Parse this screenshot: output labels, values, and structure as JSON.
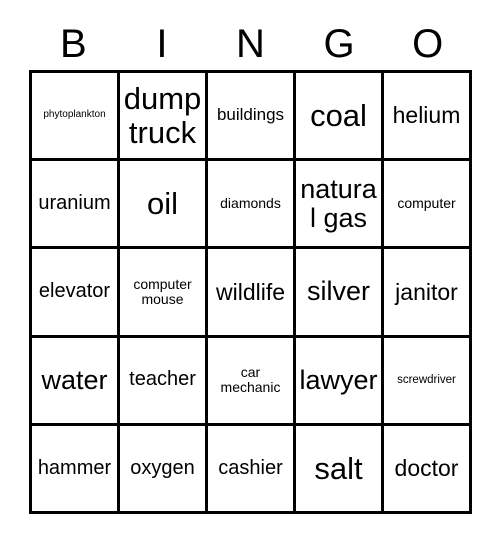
{
  "card": {
    "title": "BINGO",
    "header_letters": [
      "B",
      "I",
      "N",
      "G",
      "O"
    ],
    "columns": 5,
    "rows": 5,
    "border_color": "#000000",
    "background_color": "#ffffff",
    "text_color": "#000000",
    "cells": [
      [
        {
          "text": "phytoplankton",
          "size": "tiny"
        },
        {
          "text": "dump truck",
          "size": "xxl"
        },
        {
          "text": "buildings",
          "size": "s"
        },
        {
          "text": "coal",
          "size": "xxl"
        },
        {
          "text": "helium",
          "size": "l"
        }
      ],
      [
        {
          "text": "uranium",
          "size": "m"
        },
        {
          "text": "oil",
          "size": "xxl"
        },
        {
          "text": "diamonds",
          "size": "xs"
        },
        {
          "text": "natural gas",
          "size": "xl"
        },
        {
          "text": "computer",
          "size": "xs"
        }
      ],
      [
        {
          "text": "elevator",
          "size": "m"
        },
        {
          "text": "computer mouse",
          "size": "xs"
        },
        {
          "text": "wildlife",
          "size": "l"
        },
        {
          "text": "silver",
          "size": "xl"
        },
        {
          "text": "janitor",
          "size": "l"
        }
      ],
      [
        {
          "text": "water",
          "size": "xl"
        },
        {
          "text": "teacher",
          "size": "m"
        },
        {
          "text": "car mechanic",
          "size": "xs"
        },
        {
          "text": "lawyer",
          "size": "xl"
        },
        {
          "text": "screwdriver",
          "size": "xxs"
        }
      ],
      [
        {
          "text": "hammer",
          "size": "m"
        },
        {
          "text": "oxygen",
          "size": "m"
        },
        {
          "text": "cashier",
          "size": "m"
        },
        {
          "text": "salt",
          "size": "xxl"
        },
        {
          "text": "doctor",
          "size": "l"
        }
      ]
    ]
  }
}
